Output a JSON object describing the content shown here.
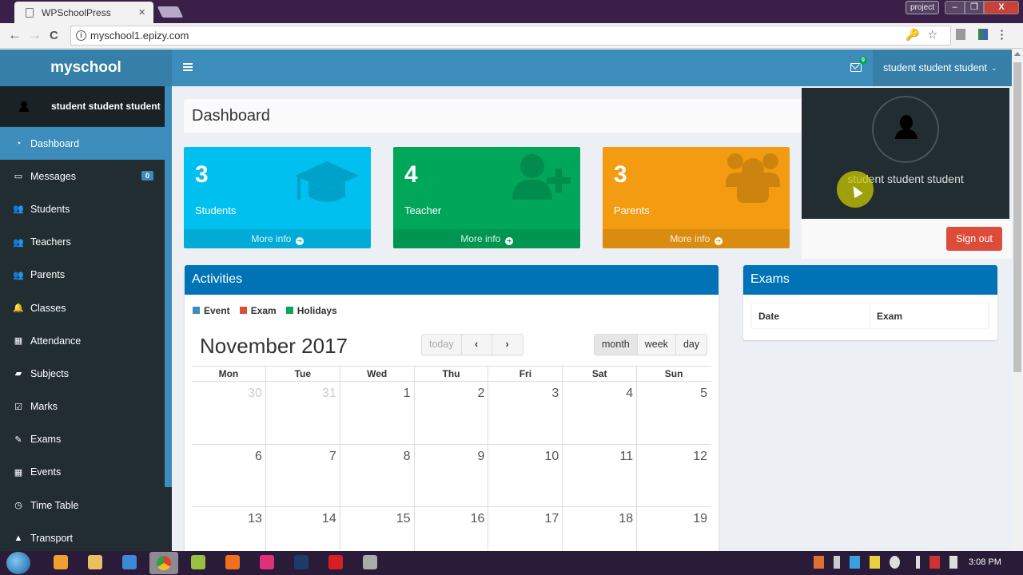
{
  "browser": {
    "tab_title": "WPSchoolPress",
    "tab_close": "×",
    "url": "myschool1.epizy.com",
    "profile": "project",
    "window_buttons": {
      "minimize": "–",
      "maximize": "❐",
      "close": "X"
    },
    "nav": {
      "back": "←",
      "forward": "→",
      "reload": "C"
    },
    "omnibox_icons": "🔑☆",
    "info_glyph": "i"
  },
  "app": {
    "logo": "myschool",
    "sidebar_user": "student student student",
    "menu": [
      {
        "label": "Dashboard",
        "icon": "dashboard-icon",
        "glyph": "◔",
        "active": true
      },
      {
        "label": "Messages",
        "icon": "inbox-icon",
        "glyph": "▭",
        "badge": "0"
      },
      {
        "label": "Students",
        "icon": "users-icon",
        "glyph": "👥"
      },
      {
        "label": "Teachers",
        "icon": "users-icon",
        "glyph": "👥"
      },
      {
        "label": "Parents",
        "icon": "users-icon",
        "glyph": "👥"
      },
      {
        "label": "Classes",
        "icon": "bell-icon",
        "glyph": "🔔"
      },
      {
        "label": "Attendance",
        "icon": "table-icon",
        "glyph": "▦"
      },
      {
        "label": "Subjects",
        "icon": "book-icon",
        "glyph": "▰"
      },
      {
        "label": "Marks",
        "icon": "check-square-icon",
        "glyph": "☑"
      },
      {
        "label": "Exams",
        "icon": "edit-icon",
        "glyph": "✎"
      },
      {
        "label": "Events",
        "icon": "calendar-icon",
        "glyph": "▦"
      },
      {
        "label": "Time Table",
        "icon": "clock-icon",
        "glyph": "◷"
      },
      {
        "label": "Transport",
        "icon": "road-icon",
        "glyph": "▲"
      }
    ],
    "header": {
      "mail_badge": "0",
      "user_menu": "student student student",
      "user_chevron": "⌄"
    },
    "page_title": "Dashboard",
    "stats": [
      {
        "value": "3",
        "label": "Students",
        "footer": "More info",
        "color": "#00c0ef",
        "icon": "graduation-cap-icon"
      },
      {
        "value": "4",
        "label": "Teacher",
        "footer": "More info",
        "color": "#00a65a",
        "icon": "user-plus-icon"
      },
      {
        "value": "3",
        "label": "Parents",
        "footer": "More info",
        "color": "#f39c12",
        "icon": "users-icon"
      }
    ],
    "arrow_glyph": "➜",
    "activities": {
      "title": "Activities",
      "legend": [
        {
          "label": "Event",
          "color": "#3c8dbc"
        },
        {
          "label": "Exam",
          "color": "#dd4b39"
        },
        {
          "label": "Holidays",
          "color": "#00a65a"
        }
      ],
      "calendar": {
        "title": "November 2017",
        "today_button": "today",
        "prev": "‹",
        "next": "›",
        "views": [
          "month",
          "week",
          "day"
        ],
        "active_view": "month",
        "weekdays": [
          "Mon",
          "Tue",
          "Wed",
          "Thu",
          "Fri",
          "Sat",
          "Sun"
        ],
        "weeks": [
          [
            {
              "d": "30",
              "other": true
            },
            {
              "d": "31",
              "other": true
            },
            {
              "d": "1"
            },
            {
              "d": "2"
            },
            {
              "d": "3"
            },
            {
              "d": "4"
            },
            {
              "d": "5"
            }
          ],
          [
            {
              "d": "6"
            },
            {
              "d": "7"
            },
            {
              "d": "8"
            },
            {
              "d": "9"
            },
            {
              "d": "10"
            },
            {
              "d": "11"
            },
            {
              "d": "12"
            }
          ],
          [
            {
              "d": "13"
            },
            {
              "d": "14"
            },
            {
              "d": "15"
            },
            {
              "d": "16"
            },
            {
              "d": "17"
            },
            {
              "d": "18"
            },
            {
              "d": "19"
            }
          ]
        ]
      }
    },
    "exams": {
      "title": "Exams",
      "columns": [
        "Date",
        "Exam"
      ]
    },
    "dropdown": {
      "name": "student student student",
      "sign_out": "Sign out"
    }
  },
  "taskbar": {
    "clock": "3:08 PM",
    "apps": [
      {
        "name": "media-player",
        "color": "#f0a030"
      },
      {
        "name": "file-explorer",
        "color": "#e8c060"
      },
      {
        "name": "internet-explorer",
        "color": "#3a8ad8"
      },
      {
        "name": "chrome",
        "color": "#e04030",
        "active": true
      },
      {
        "name": "android-studio",
        "color": "#9ac040"
      },
      {
        "name": "firefox",
        "color": "#f07020"
      },
      {
        "name": "flickr",
        "color": "#e0307a"
      },
      {
        "name": "photoshop",
        "color": "#1e3a6a"
      },
      {
        "name": "opera",
        "color": "#d81f26"
      },
      {
        "name": "app-misc",
        "color": "#aaaaaa"
      }
    ]
  }
}
